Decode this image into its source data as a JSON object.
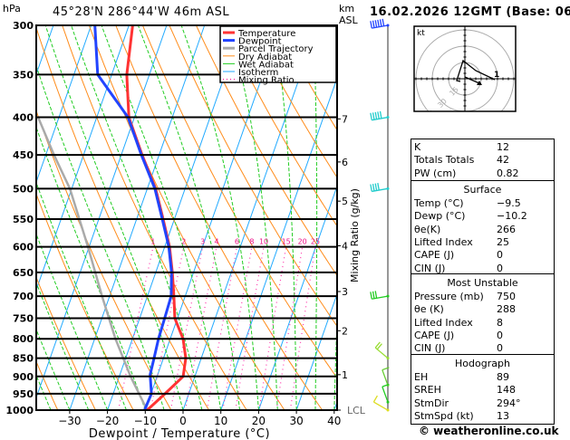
{
  "header": {
    "pressure_unit": "hPa",
    "location": "45°28'N  286°44'W  46m  ASL",
    "height_unit_line1": "km",
    "height_unit_line2": "ASL",
    "datetime": "16.02.2026  12GMT  (Base: 06)"
  },
  "footer": {
    "copyright": "© weatheronline.co.uk"
  },
  "colors": {
    "temperature": "#ff3333",
    "dewpoint": "#2244ff",
    "parcel": "#aaaaaa",
    "dry_adiabat": "#ff8c1a",
    "wet_adiabat": "#22cc22",
    "isotherm": "#22aaff",
    "mixing_ratio": "#ff33aa"
  },
  "chart_data": {
    "type": "skew-t",
    "xlabel": "Dewpoint / Temperature (°C)",
    "ylabel": "hPa",
    "right_axis_label": "Mixing Ratio (g/kg)",
    "x_ticks": [
      -30,
      -20,
      -10,
      0,
      10,
      20,
      30,
      40
    ],
    "x_tick_labels": [
      "−30",
      "−20",
      "−10",
      "0",
      "10",
      "20",
      "30",
      "40"
    ],
    "y_ticks": [
      300,
      350,
      400,
      450,
      500,
      550,
      600,
      650,
      700,
      750,
      800,
      850,
      900,
      950,
      1000
    ],
    "ylim": [
      1000,
      300
    ],
    "xlim_at_1000hPa": [
      -39,
      41
    ],
    "legend": [
      "Temperature",
      "Dewpoint",
      "Parcel Trajectory",
      "Dry Adiabat",
      "Wet Adiabat",
      "Isotherm",
      "Mixing Ratio"
    ],
    "legend_position": "top-right",
    "height_km_labels": [
      {
        "km": "7",
        "p": 402
      },
      {
        "km": "6",
        "p": 460
      },
      {
        "km": "5",
        "p": 520
      },
      {
        "km": "4",
        "p": 598
      },
      {
        "km": "3",
        "p": 690
      },
      {
        "km": "2",
        "p": 780
      },
      {
        "km": "1",
        "p": 895
      },
      {
        "km": "LCL",
        "p": 1000
      }
    ],
    "mixing_ratio_labels": [
      "1",
      "2",
      "3",
      "4",
      "6",
      "8",
      "10",
      "15",
      "20",
      "25"
    ],
    "temperature": {
      "p": [
        1000,
        950,
        900,
        850,
        800,
        750,
        700,
        650,
        600,
        550,
        500,
        450,
        400,
        350,
        300
      ],
      "t": [
        -9.5,
        -6.3,
        -3.1,
        -4.1,
        -6.6,
        -10.7,
        -13,
        -15.6,
        -18.7,
        -23,
        -27.8,
        -34.5,
        -41.5,
        -46,
        -49
      ]
    },
    "dewpoint": {
      "p": [
        1000,
        950,
        895,
        850,
        800,
        750,
        700,
        650,
        600,
        550,
        500,
        450,
        400,
        350,
        300
      ],
      "t": [
        -10.2,
        -9.9,
        -12,
        -12.5,
        -13.1,
        -13.4,
        -13.7,
        -15.8,
        -18.9,
        -23.2,
        -28,
        -34.7,
        -41.7,
        -53.7,
        -59
      ]
    },
    "parcel": {
      "p": [
        1000,
        900,
        800,
        700,
        600,
        500,
        450,
        400
      ],
      "t": [
        -9.5,
        -17,
        -24.5,
        -32,
        -40.3,
        -50.5,
        -57.8,
        -65.5
      ]
    },
    "wind_barbs": [
      {
        "p": 300,
        "dir": 280,
        "speed_kt": 60,
        "color": "#2244ff"
      },
      {
        "p": 400,
        "dir": 280,
        "speed_kt": 45,
        "color": "#22cccc"
      },
      {
        "p": 500,
        "dir": 280,
        "speed_kt": 40,
        "color": "#22cccc"
      },
      {
        "p": 700,
        "dir": 280,
        "speed_kt": 25,
        "color": "#22cc22"
      },
      {
        "p": 850,
        "dir": 230,
        "speed_kt": 15,
        "color": "#99dd33"
      },
      {
        "p": 925,
        "dir": 200,
        "speed_kt": 10,
        "color": "#66cc33"
      },
      {
        "p": 975,
        "dir": 200,
        "speed_kt": 10,
        "color": "#22cc22"
      },
      {
        "p": 1000,
        "dir": 240,
        "speed_kt": 10,
        "color": "#dddd22"
      }
    ]
  },
  "hodograph": {
    "unit": "kt",
    "ring_labels": [
      "15",
      "30",
      "45"
    ],
    "point_label": "1"
  },
  "indices": {
    "rows": [
      {
        "label": "K",
        "value": "12"
      },
      {
        "label": "Totals Totals",
        "value": "42"
      },
      {
        "label": "PW (cm)",
        "value": "0.82"
      }
    ],
    "surface": {
      "title": "Surface",
      "rows": [
        {
          "label": "Temp (°C)",
          "value": "−9.5"
        },
        {
          "label": "Dewp (°C)",
          "value": "−10.2"
        },
        {
          "label": "θe(K)",
          "value": "266"
        },
        {
          "label": "Lifted Index",
          "value": "25"
        },
        {
          "label": "CAPE (J)",
          "value": "0"
        },
        {
          "label": "CIN (J)",
          "value": "0"
        }
      ]
    },
    "most_unstable": {
      "title": "Most Unstable",
      "rows": [
        {
          "label": "Pressure (mb)",
          "value": "750"
        },
        {
          "label": "θe (K)",
          "value": "288"
        },
        {
          "label": "Lifted Index",
          "value": "8"
        },
        {
          "label": "CAPE (J)",
          "value": "0"
        },
        {
          "label": "CIN (J)",
          "value": "0"
        }
      ]
    },
    "hodograph": {
      "title": "Hodograph",
      "rows": [
        {
          "label": "EH",
          "value": "89"
        },
        {
          "label": "SREH",
          "value": "148"
        },
        {
          "label": "StmDir",
          "value": "294°"
        },
        {
          "label": "StmSpd (kt)",
          "value": "13"
        }
      ]
    }
  }
}
